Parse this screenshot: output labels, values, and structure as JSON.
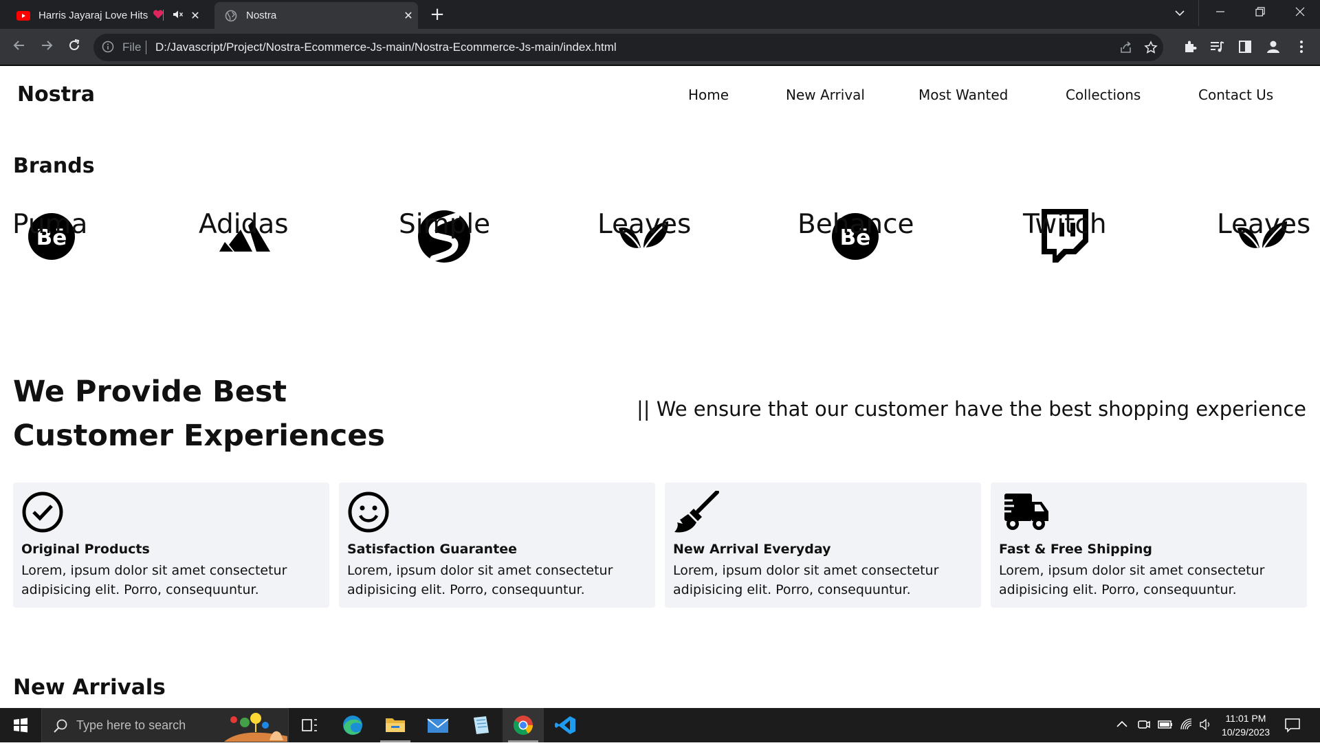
{
  "browser": {
    "tabs": [
      {
        "title": "Harris Jayaraj Love Hits",
        "active": false,
        "favicon": "youtube-icon",
        "audio": "muted-speaker-icon"
      },
      {
        "title": "Nostra",
        "active": true,
        "favicon": "globe-icon"
      }
    ],
    "address": {
      "scheme_label": "File",
      "url": "D:/Javascript/Project/Nostra-Ecommerce-Js-main/Nostra-Ecommerce-Js-main/index.html"
    },
    "theme_color": "#35363a"
  },
  "site": {
    "logo": "Nostra",
    "nav": [
      "Home",
      "New Arrival",
      "Most Wanted",
      "Collections",
      "Contact Us"
    ],
    "brands_title": "Brands",
    "brands": [
      {
        "name": "Puma",
        "icon": "behance-icon"
      },
      {
        "name": "Adidas",
        "icon": "adidas-icon"
      },
      {
        "name": "Simple",
        "icon": "simple-icon"
      },
      {
        "name": "Leaves",
        "icon": "leaves-icon"
      },
      {
        "name": "Behance",
        "icon": "behance-icon"
      },
      {
        "name": "Twitch",
        "icon": "twitch-icon"
      },
      {
        "name": "Leaves",
        "icon": "leaves-icon"
      }
    ],
    "experience": {
      "heading_line1": "We Provide Best",
      "heading_line2": "Customer Experiences",
      "tagline": "|| We ensure that our customer have the best shopping experience"
    },
    "features": [
      {
        "title": "Original Products",
        "text": "Lorem, ipsum dolor sit amet consectetur adipisicing elit. Porro, consequuntur.",
        "icon": "check-circle-icon"
      },
      {
        "title": "Satisfaction Guarantee",
        "text": "Lorem, ipsum dolor sit amet consectetur adipisicing elit. Porro, consequuntur.",
        "icon": "smile-icon"
      },
      {
        "title": "New Arrival Everyday",
        "text": "Lorem, ipsum dolor sit amet consectetur adipisicing elit. Porro, consequuntur.",
        "icon": "broom-icon"
      },
      {
        "title": "Fast & Free Shipping",
        "text": "Lorem, ipsum dolor sit amet consectetur adipisicing elit. Porro, consequuntur.",
        "icon": "truck-icon"
      }
    ],
    "new_arrivals_title": "New Arrivals",
    "card_bg": "#f2f3f6"
  },
  "taskbar": {
    "search_placeholder": "Type here to search",
    "time": "11:01 PM",
    "date": "10/29/2023",
    "apps": [
      "task-view-icon",
      "edge-icon",
      "file-explorer-icon",
      "mail-icon",
      "notepad-icon",
      "chrome-icon",
      "vscode-icon"
    ]
  }
}
